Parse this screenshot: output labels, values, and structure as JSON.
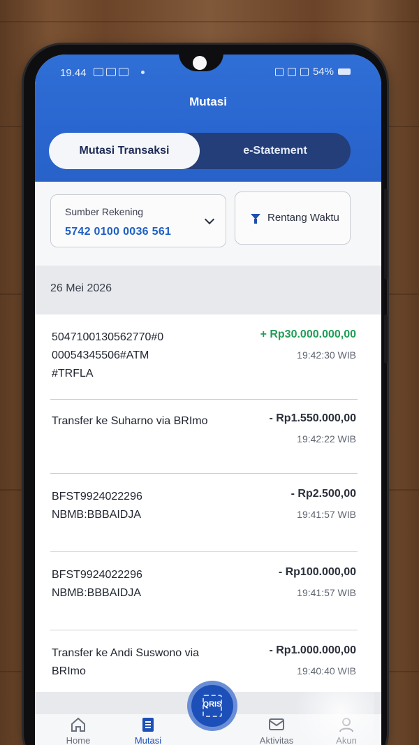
{
  "status_bar": {
    "time": "19.44",
    "battery": "54%"
  },
  "header": {
    "title": "Mutasi"
  },
  "tabs": [
    {
      "label": "Mutasi Transaksi",
      "active": true
    },
    {
      "label": "e-Statement",
      "active": false
    }
  ],
  "filters": {
    "account_label": "Sumber Rekening",
    "account_number": "5742 0100 0036 561",
    "range_label": "Rentang Waktu"
  },
  "date_header": "26 Mei 2026",
  "transactions": [
    {
      "description": "5047100130562770#0\n00054345506#ATM\n#TRFLA",
      "amount": "+ Rp30.000.000,00",
      "time": "19:42:30 WIB",
      "type": "credit"
    },
    {
      "description": "Transfer ke Suharno via BRImo",
      "amount": "- Rp1.550.000,00",
      "time": "19:42:22 WIB",
      "type": "debit"
    },
    {
      "description": "BFST9924022296\nNBMB:BBBAIDJA",
      "amount": "- Rp2.500,00",
      "time": "19:41:57 WIB",
      "type": "debit"
    },
    {
      "description": "BFST9924022296\nNBMB:BBBAIDJA",
      "amount": "- Rp100.000,00",
      "time": "19:41:57 WIB",
      "type": "debit"
    },
    {
      "description": "Transfer ke Andi Suswono via\nBRImo",
      "amount": "- Rp1.000.000,00",
      "time": "19:40:40 WIB",
      "type": "debit"
    }
  ],
  "bottom_nav": {
    "home": "Home",
    "mutasi": "Mutasi",
    "qris": "QRIS",
    "aktivitas": "Aktivitas",
    "akun": "Akun"
  },
  "colors": {
    "header_blue": "#2a66cf",
    "credit_green": "#1f9d55",
    "account_blue": "#1e5fc4"
  }
}
